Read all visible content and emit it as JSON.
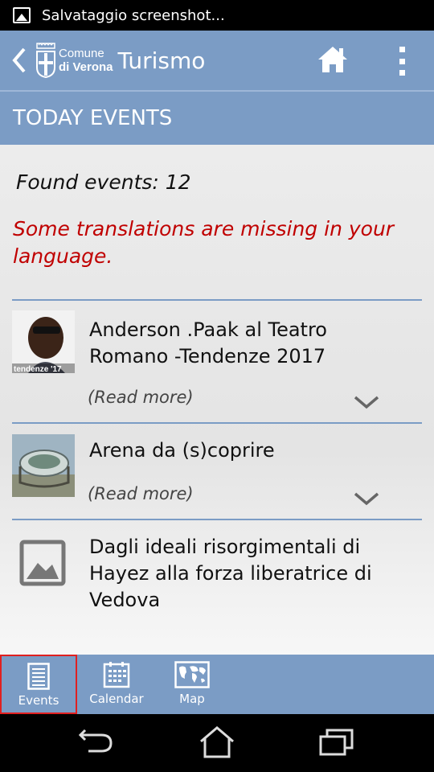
{
  "status_bar": {
    "notification_text": "Salvataggio screenshot..."
  },
  "app_bar": {
    "logo_line1": "Comune",
    "logo_line2": "di Verona",
    "title": "Turismo"
  },
  "section": {
    "title": "TODAY EVENTS"
  },
  "content": {
    "found_text": "Found events: 12",
    "warning_text": "Some translations are missing in your language."
  },
  "events": [
    {
      "title": "Anderson .Paak al Teatro Romano -Tendenze 2017",
      "read_more": "(Read more)",
      "thumb_caption": "tendenze '17"
    },
    {
      "title": "Arena da (s)coprire",
      "read_more": "(Read more)"
    },
    {
      "title": "Dagli ideali risorgimentali di Hayez alla forza liberatrice di Vedova"
    }
  ],
  "bottom_nav": {
    "items": [
      {
        "label": "Events",
        "icon": "document-list-icon",
        "selected": true
      },
      {
        "label": "Calendar",
        "icon": "calendar-icon"
      },
      {
        "label": "Map",
        "icon": "world-map-icon"
      }
    ]
  },
  "colors": {
    "bar": "#7b9cc5",
    "warning": "#c00000",
    "selected_outline": "#e02020"
  }
}
